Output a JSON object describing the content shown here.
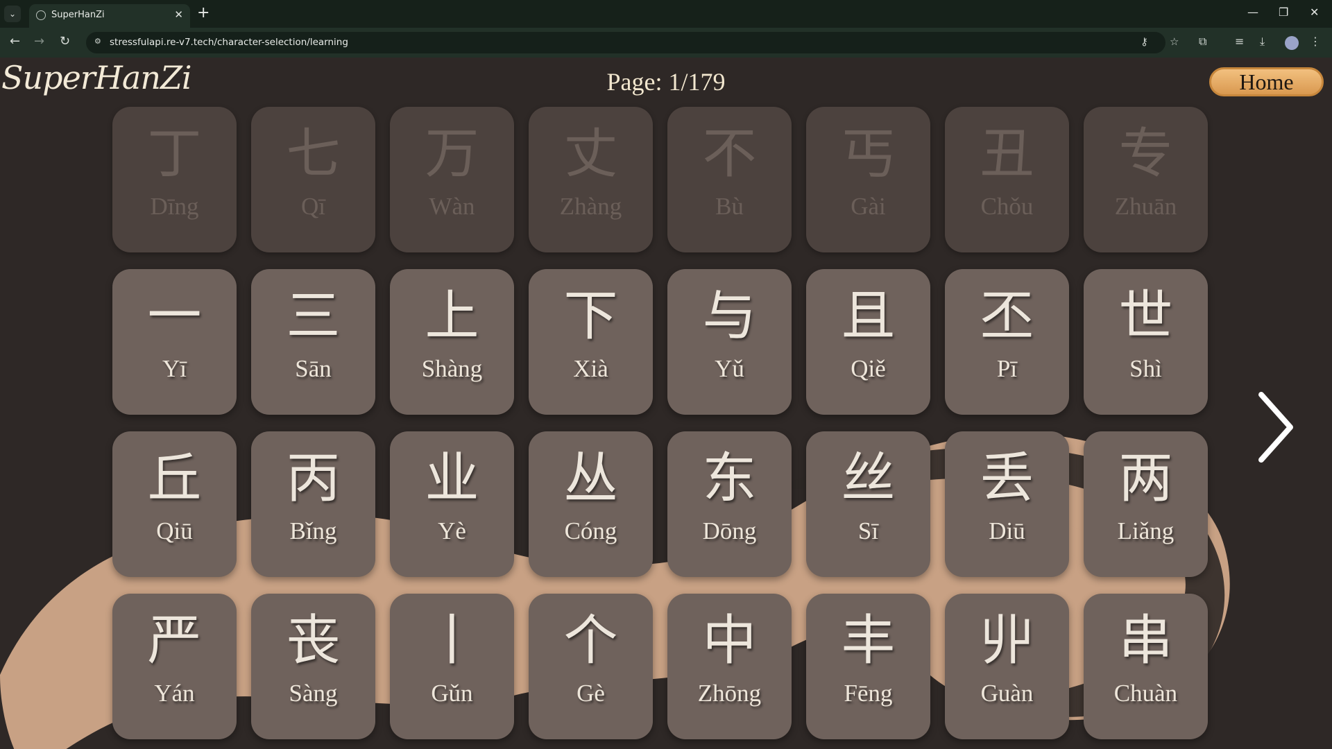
{
  "browser": {
    "tab_title": "SuperHanZi",
    "url": "stressfulapi.re-v7.tech/character-selection/learning"
  },
  "app": {
    "logo": "SuperHanZi",
    "page_indicator": "Page: 1/179",
    "home_label": "Home"
  },
  "characters": [
    {
      "hanzi": "丁",
      "pinyin": "Dīng",
      "enabled": false
    },
    {
      "hanzi": "七",
      "pinyin": "Qī",
      "enabled": false
    },
    {
      "hanzi": "万",
      "pinyin": "Wàn",
      "enabled": false
    },
    {
      "hanzi": "丈",
      "pinyin": "Zhàng",
      "enabled": false
    },
    {
      "hanzi": "不",
      "pinyin": "Bù",
      "enabled": false
    },
    {
      "hanzi": "丐",
      "pinyin": "Gài",
      "enabled": false
    },
    {
      "hanzi": "丑",
      "pinyin": "Chǒu",
      "enabled": false
    },
    {
      "hanzi": "专",
      "pinyin": "Zhuān",
      "enabled": false
    },
    {
      "hanzi": "一",
      "pinyin": "Yī",
      "enabled": true
    },
    {
      "hanzi": "三",
      "pinyin": "Sān",
      "enabled": true
    },
    {
      "hanzi": "上",
      "pinyin": "Shàng",
      "enabled": true
    },
    {
      "hanzi": "下",
      "pinyin": "Xià",
      "enabled": true
    },
    {
      "hanzi": "与",
      "pinyin": "Yǔ",
      "enabled": true
    },
    {
      "hanzi": "且",
      "pinyin": "Qiě",
      "enabled": true
    },
    {
      "hanzi": "丕",
      "pinyin": "Pī",
      "enabled": true
    },
    {
      "hanzi": "世",
      "pinyin": "Shì",
      "enabled": true
    },
    {
      "hanzi": "丘",
      "pinyin": "Qiū",
      "enabled": true
    },
    {
      "hanzi": "丙",
      "pinyin": "Bǐng",
      "enabled": true
    },
    {
      "hanzi": "业",
      "pinyin": "Yè",
      "enabled": true
    },
    {
      "hanzi": "丛",
      "pinyin": "Cóng",
      "enabled": true
    },
    {
      "hanzi": "东",
      "pinyin": "Dōng",
      "enabled": true
    },
    {
      "hanzi": "丝",
      "pinyin": "Sī",
      "enabled": true
    },
    {
      "hanzi": "丢",
      "pinyin": "Diū",
      "enabled": true
    },
    {
      "hanzi": "两",
      "pinyin": "Liǎng",
      "enabled": true
    },
    {
      "hanzi": "严",
      "pinyin": "Yán",
      "enabled": true
    },
    {
      "hanzi": "丧",
      "pinyin": "Sàng",
      "enabled": true
    },
    {
      "hanzi": "丨",
      "pinyin": "Gǔn",
      "enabled": true
    },
    {
      "hanzi": "个",
      "pinyin": "Gè",
      "enabled": true
    },
    {
      "hanzi": "中",
      "pinyin": "Zhōng",
      "enabled": true
    },
    {
      "hanzi": "丰",
      "pinyin": "Fēng",
      "enabled": true
    },
    {
      "hanzi": "丱",
      "pinyin": "Guàn",
      "enabled": true
    },
    {
      "hanzi": "串",
      "pinyin": "Chuàn",
      "enabled": true
    }
  ]
}
